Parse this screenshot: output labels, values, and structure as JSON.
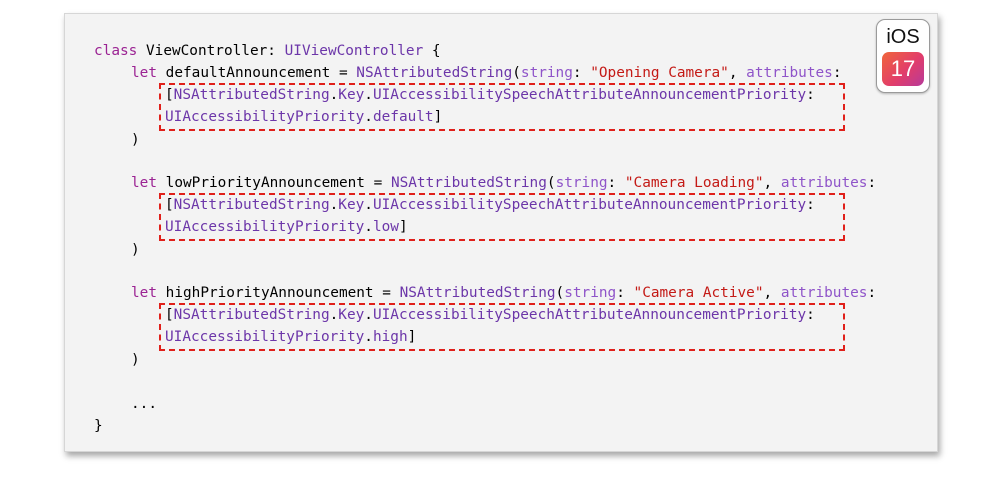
{
  "badge": {
    "os": "iOS",
    "version": "17"
  },
  "code": {
    "l1": {
      "kw": "class",
      "name": " ViewController: ",
      "type": "UIViewController",
      "tail": " {"
    },
    "blocks": [
      {
        "kw": "let",
        "var": " defaultAnnouncement = ",
        "cls": "NSAttributedString",
        "open": "(",
        "arg1": "string",
        "sep": ": ",
        "str": "\"Opening Camera\"",
        "comma": ", ",
        "arg2": "attributes",
        "colon": ":",
        "key_open": "[",
        "key_cls": "NSAttributedString",
        "key_dot1": ".",
        "key_key": "Key",
        "key_dot2": ".",
        "key_member": "UIAccessibilitySpeechAttributeAnnouncementPriority",
        "key_colon": ":",
        "val_type": "UIAccessibilityPriority",
        "val_dot": ".",
        "val_member": "default",
        "val_close": "]",
        "close": ")"
      },
      {
        "kw": "let",
        "var": " lowPriorityAnnouncement = ",
        "cls": "NSAttributedString",
        "open": "(",
        "arg1": "string",
        "sep": ": ",
        "str": "\"Camera Loading\"",
        "comma": ", ",
        "arg2": "attributes",
        "colon": ":",
        "key_open": "[",
        "key_cls": "NSAttributedString",
        "key_dot1": ".",
        "key_key": "Key",
        "key_dot2": ".",
        "key_member": "UIAccessibilitySpeechAttributeAnnouncementPriority",
        "key_colon": ":",
        "val_type": "UIAccessibilityPriority",
        "val_dot": ".",
        "val_member": "low",
        "val_close": "]",
        "close": ")"
      },
      {
        "kw": "let",
        "var": " highPriorityAnnouncement = ",
        "cls": "NSAttributedString",
        "open": "(",
        "arg1": "string",
        "sep": ": ",
        "str": "\"Camera Active\"",
        "comma": ", ",
        "arg2": "attributes",
        "colon": ":",
        "key_open": "[",
        "key_cls": "NSAttributedString",
        "key_dot1": ".",
        "key_key": "Key",
        "key_dot2": ".",
        "key_member": "UIAccessibilitySpeechAttributeAnnouncementPriority",
        "key_colon": ":",
        "val_type": "UIAccessibilityPriority",
        "val_dot": ".",
        "val_member": "high",
        "val_close": "]",
        "close": ")"
      }
    ],
    "ellipsis": "...",
    "end": "}"
  },
  "colors": {
    "keyword": "#9b2393",
    "type": "#6c36a9",
    "string": "#c41a16",
    "highlight": "#e0201a"
  }
}
